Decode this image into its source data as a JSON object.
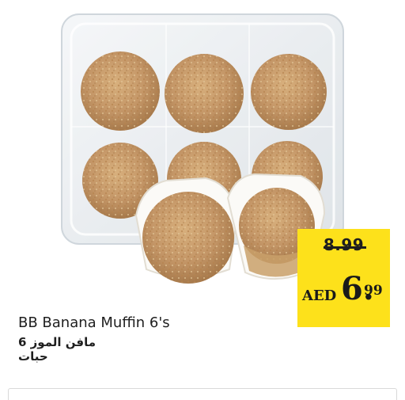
{
  "product": {
    "name_en": "BB Banana Muffin 6's",
    "name_ar": "مافن الموز 6 حبات",
    "image_icon": "muffin-pack-icon"
  },
  "price": {
    "old": "8.99",
    "currency": "AED",
    "new_main": "6.",
    "new_cents": "99"
  },
  "colors": {
    "price_tag": "#fde11b",
    "muffin": "#c9a06a",
    "tray": "#e8edf1"
  }
}
